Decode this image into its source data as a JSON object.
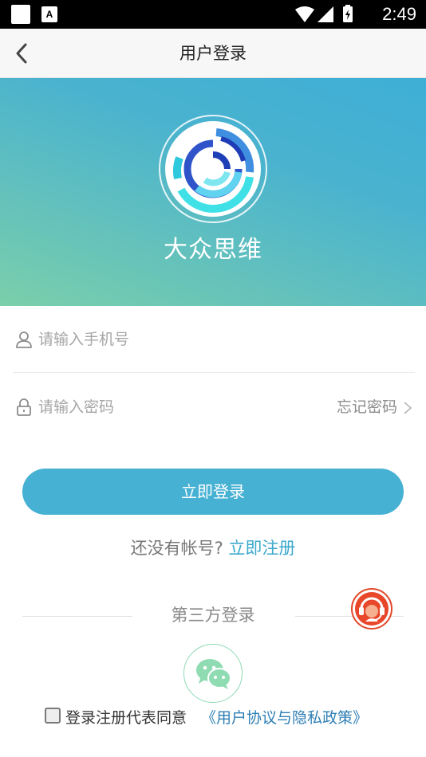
{
  "status_bar": {
    "app_badge": "A",
    "time": "2:49"
  },
  "nav": {
    "title": "用户登录",
    "back_icon": "chevron-left-icon"
  },
  "banner": {
    "brand_name": "大众思维",
    "colors": {
      "gradient_start": "#3fafd6",
      "gradient_end": "#7acfaa"
    }
  },
  "form": {
    "phone_placeholder": "请输入手机号",
    "phone_value": "",
    "password_placeholder": "请输入密码",
    "password_value": "",
    "forgot_label": "忘记密码"
  },
  "login_button": {
    "label": "立即登录",
    "color": "#46b1d3"
  },
  "register": {
    "prompt": "还没有帐号?",
    "link": "立即注册"
  },
  "third_party": {
    "title": "第三方登录",
    "wechat_icon": "wechat-icon"
  },
  "agreement": {
    "checked": false,
    "text": "登录注册代表同意",
    "policy_link": "《用户协议与隐私政策》"
  },
  "support_icon": "customer-service-icon"
}
